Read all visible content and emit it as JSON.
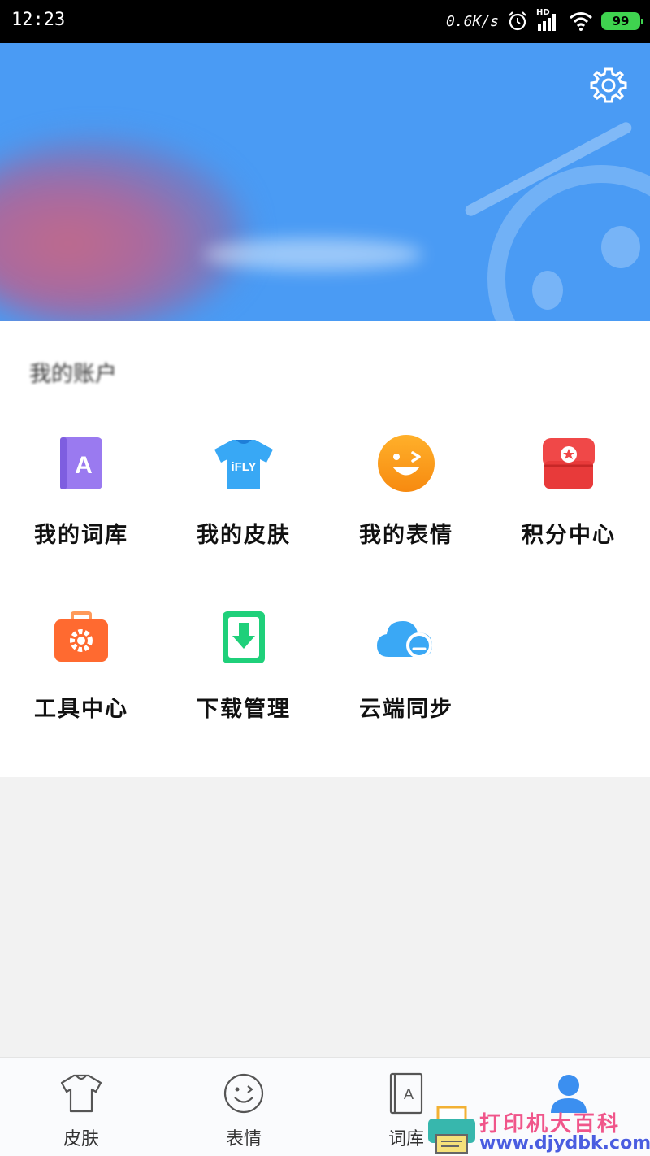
{
  "status_bar": {
    "time": "12:23",
    "net_speed": "0.6K/s",
    "signal_label": "HD",
    "battery": "99"
  },
  "header": {
    "settings_icon": "gear-icon",
    "banner_color": "#4a9bf4"
  },
  "account": {
    "title": "我的账户"
  },
  "grid": [
    {
      "label": "我的词库",
      "icon": "dictionary-book-icon"
    },
    {
      "label": "我的皮肤",
      "icon": "tshirt-skin-icon",
      "icon_text": "iFLY"
    },
    {
      "label": "我的表情",
      "icon": "wink-face-icon"
    },
    {
      "label": "积分中心",
      "icon": "points-shop-icon"
    },
    {
      "label": "工具中心",
      "icon": "toolbox-gear-icon"
    },
    {
      "label": "下载管理",
      "icon": "download-icon"
    },
    {
      "label": "云端同步",
      "icon": "cloud-sync-icon"
    }
  ],
  "bottom_nav": [
    {
      "label": "皮肤",
      "icon": "tshirt-icon"
    },
    {
      "label": "表情",
      "icon": "smiley-icon"
    },
    {
      "label": "词库",
      "icon": "book-a-icon",
      "icon_text": "A"
    },
    {
      "label": "",
      "icon": "person-icon",
      "active": true
    }
  ],
  "watermark": {
    "title": "打印机大百科",
    "url": "www.djydbk.com"
  }
}
